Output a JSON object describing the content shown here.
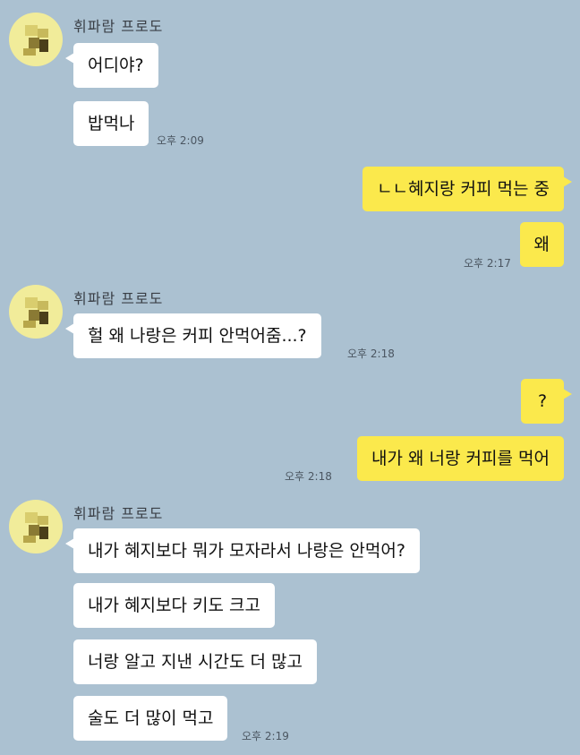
{
  "sender": "휘파람 프로도",
  "groups": [
    {
      "messages": [
        "어디야?",
        "밥먹나"
      ],
      "time": "오후 2:09"
    },
    {
      "outgoing": [
        "ㄴㄴ혜지랑 커피 먹는 중",
        "왜"
      ],
      "time": "오후 2:17"
    },
    {
      "messages": [
        "헐 왜 나랑은 커피 안먹어줌...?"
      ],
      "time": "오후 2:18"
    },
    {
      "outgoing": [
        "?",
        "내가 왜 너랑 커피를 먹어"
      ],
      "time": "오후 2:18"
    },
    {
      "messages": [
        "내가 혜지보다 뭐가 모자라서 나랑은 안먹어?",
        "내가 혜지보다 키도 크고",
        "너랑 알고 지낸 시간도 더 많고",
        "술도 더 많이 먹고"
      ],
      "time": "오후 2:19"
    }
  ],
  "colors": {
    "background": "#abc1d1",
    "incoming_bubble": "#ffffff",
    "outgoing_bubble": "#fbe94c",
    "avatar": "#f1ec9a"
  }
}
